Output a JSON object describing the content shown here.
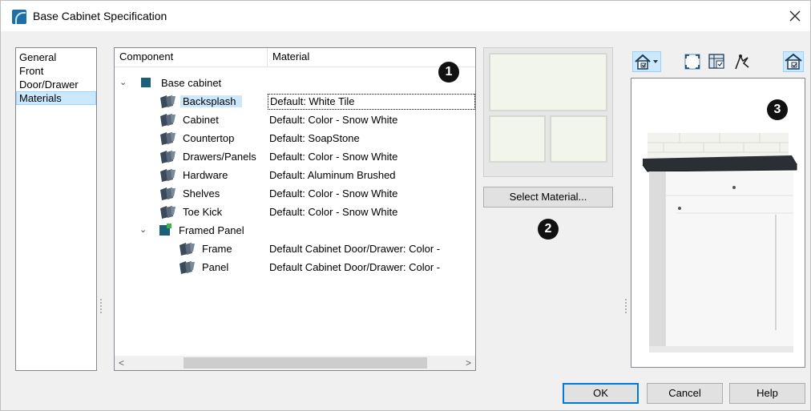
{
  "window": {
    "title": "Base Cabinet Specification",
    "close_glyph": "×"
  },
  "nav": {
    "items": [
      {
        "label": "General",
        "selected": false
      },
      {
        "label": "Front",
        "selected": false
      },
      {
        "label": "Door/Drawer",
        "selected": false
      },
      {
        "label": "Materials",
        "selected": true
      }
    ]
  },
  "tree": {
    "columns": [
      "Component",
      "Material"
    ],
    "rows": [
      {
        "label": "Base cabinet",
        "material": "",
        "level": 0,
        "expanded": true,
        "icon": "cube-icon"
      },
      {
        "label": "Backsplash",
        "material": "Default: White Tile",
        "level": 1,
        "selected": true,
        "icon": "material-icon"
      },
      {
        "label": "Cabinet",
        "material": "Default: Color - Snow White",
        "level": 1,
        "icon": "material-icon"
      },
      {
        "label": "Countertop",
        "material": "Default: SoapStone",
        "level": 1,
        "icon": "material-icon"
      },
      {
        "label": "Drawers/Panels",
        "material": "Default: Color - Snow White",
        "level": 1,
        "icon": "material-icon"
      },
      {
        "label": "Hardware",
        "material": "Default: Aluminum Brushed",
        "level": 1,
        "icon": "material-icon"
      },
      {
        "label": "Shelves",
        "material": "Default: Color - Snow White",
        "level": 1,
        "icon": "material-icon"
      },
      {
        "label": "Toe Kick",
        "material": "Default: Color - Snow White",
        "level": 1,
        "icon": "material-icon"
      },
      {
        "label": "Framed Panel",
        "material": "",
        "level": 1,
        "expanded": true,
        "icon": "framed-panel-icon"
      },
      {
        "label": "Frame",
        "material": "Default Cabinet Door/Drawer: Color -",
        "level": 2,
        "icon": "material-icon"
      },
      {
        "label": "Panel",
        "material": "Default Cabinet Door/Drawer: Color -",
        "level": 2,
        "icon": "material-icon"
      }
    ],
    "scroll_left": "<",
    "scroll_right": ">"
  },
  "callouts": [
    "1",
    "2",
    "3"
  ],
  "swatch": {
    "name": "White Tile"
  },
  "buttons": {
    "select_material": "Select Material...",
    "ok": "OK",
    "cancel": "Cancel",
    "help": "Help"
  },
  "toolbar": {
    "icons": [
      "camera-view-icon",
      "fill-window-icon",
      "show-all-materials-icon",
      "render-options-icon",
      "active-view-icon"
    ]
  },
  "colors": {
    "accent": "#0078d7",
    "selection": "#cce8ff",
    "countertop": "#2b2f33",
    "backsplash": "#f2f2ee"
  }
}
